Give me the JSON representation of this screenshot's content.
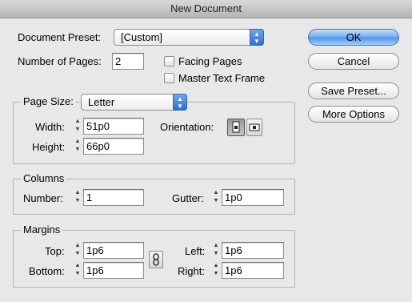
{
  "window": {
    "title": "New Document"
  },
  "document_preset": {
    "label": "Document Preset:",
    "value": "[Custom]"
  },
  "pages": {
    "label": "Number of Pages:",
    "value": "2",
    "facing_pages": {
      "label": "Facing Pages",
      "checked": false
    },
    "master_text_frame": {
      "label": "Master Text Frame",
      "checked": false
    }
  },
  "buttons": {
    "ok": "OK",
    "cancel": "Cancel",
    "save_preset": "Save Preset...",
    "more_options": "More Options"
  },
  "page_size": {
    "label": "Page Size:",
    "value": "Letter",
    "width": {
      "label": "Width:",
      "value": "51p0"
    },
    "height": {
      "label": "Height:",
      "value": "66p0"
    },
    "orientation": {
      "label": "Orientation:",
      "selected": "portrait",
      "icons": [
        "portrait-icon",
        "landscape-icon"
      ]
    }
  },
  "columns": {
    "legend": "Columns",
    "number": {
      "label": "Number:",
      "value": "1"
    },
    "gutter": {
      "label": "Gutter:",
      "value": "1p0"
    }
  },
  "margins": {
    "legend": "Margins",
    "top": {
      "label": "Top:",
      "value": "1p6"
    },
    "bottom": {
      "label": "Bottom:",
      "value": "1p6"
    },
    "left": {
      "label": "Left:",
      "value": "1p6"
    },
    "right": {
      "label": "Right:",
      "value": "1p6"
    },
    "link_icon": "chain-link-icon"
  },
  "colors": {
    "accent": "#4d91ea",
    "background": "#e8e8e8"
  }
}
